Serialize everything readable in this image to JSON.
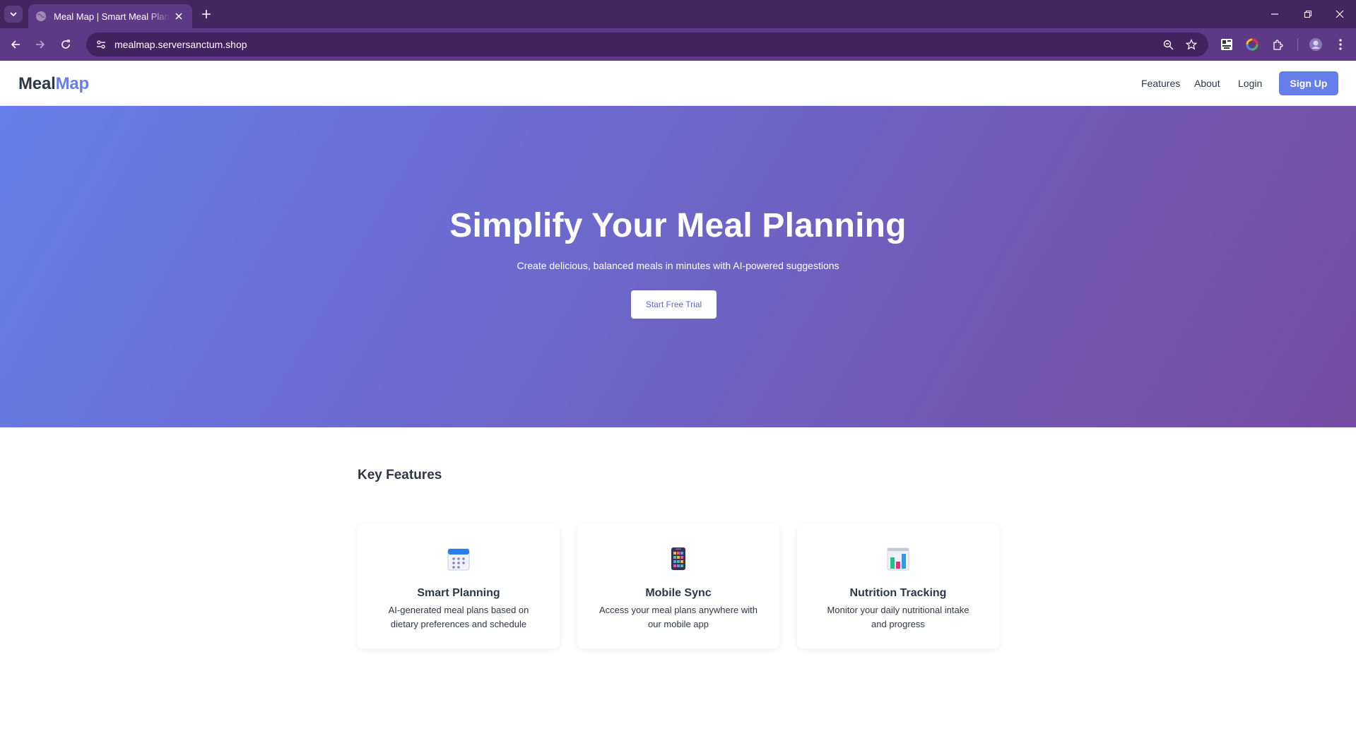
{
  "browser": {
    "tab_title": "Meal Map | Smart Meal Planning",
    "url": "mealmap.serversanctum.shop"
  },
  "site": {
    "logo": {
      "part1": "Meal",
      "part2": "Map"
    },
    "nav": {
      "features": "Features",
      "about": "About",
      "login": "Login",
      "signup": "Sign Up"
    }
  },
  "hero": {
    "title": "Simplify Your Meal Planning",
    "subtitle": "Create delicious, balanced meals in minutes with AI-powered suggestions",
    "cta": "Start Free Trial"
  },
  "features": {
    "heading": "Key Features",
    "items": [
      {
        "icon": "calendar-icon",
        "title": "Smart Planning",
        "description": "AI-generated meal plans based on dietary preferences and schedule"
      },
      {
        "icon": "mobile-phone-icon",
        "title": "Mobile Sync",
        "description": "Access your meal plans anywhere with our mobile app"
      },
      {
        "icon": "bar-chart-icon",
        "title": "Nutrition Tracking",
        "description": "Monitor your daily nutritional intake and progress"
      }
    ]
  },
  "colors": {
    "brand": "#667eea",
    "gradient_end": "#764ba2",
    "text": "#2d3748",
    "browser_frame": "#43255f"
  }
}
